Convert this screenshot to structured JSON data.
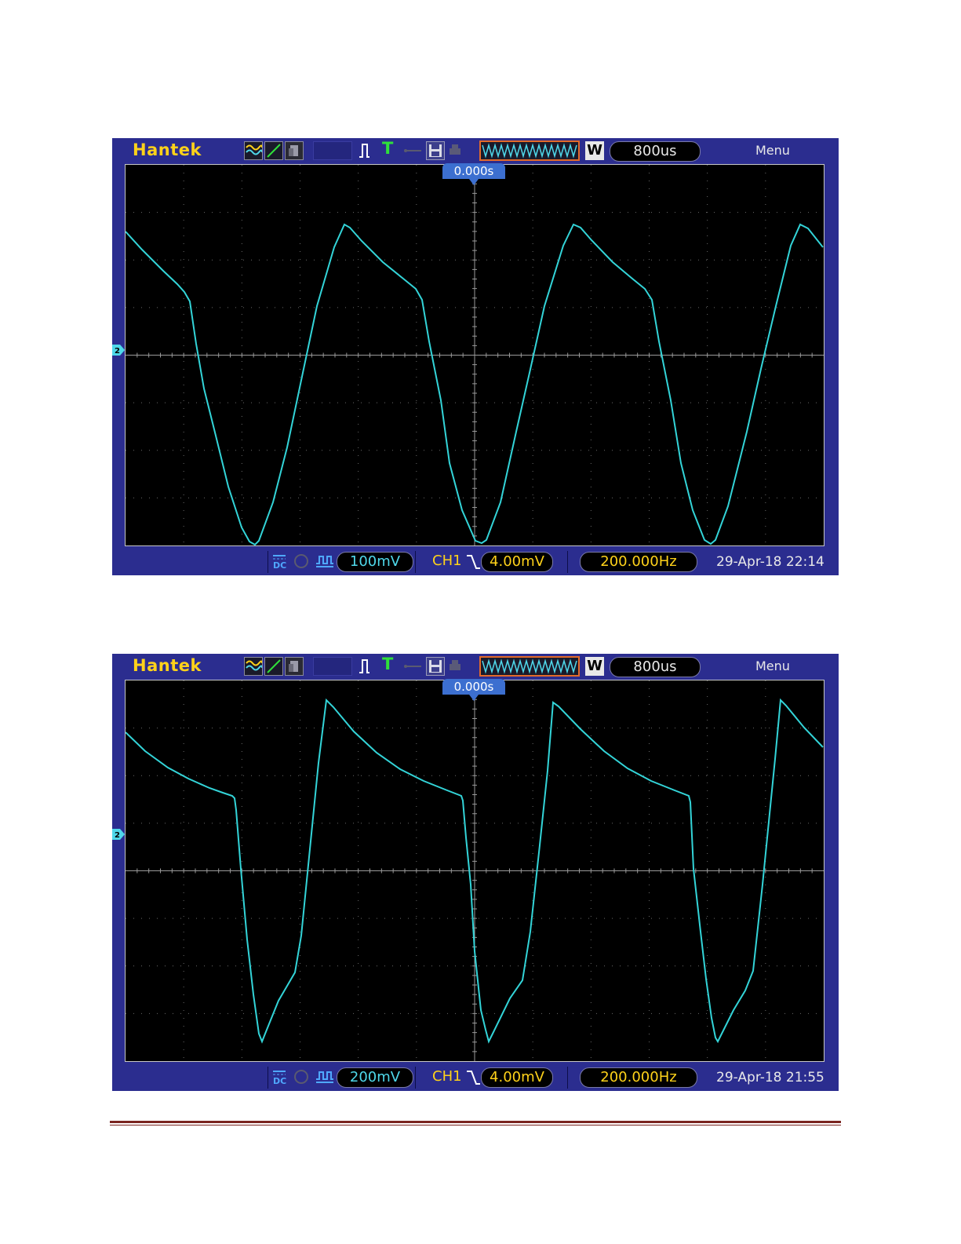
{
  "scopes": [
    {
      "brand": "Hantek",
      "timebase": "800us",
      "menu_label": "Menu",
      "trigger_position": "0.000s",
      "channel_marker": "2",
      "coupling": "DC",
      "volts_per_div": "100mV",
      "trigger_source": "CH1",
      "trigger_level": "4.00mV",
      "frequency": "200.000Hz",
      "datetime": "29-Apr-18 22:14",
      "trace_color": "#33d4d8"
    },
    {
      "brand": "Hantek",
      "timebase": "800us",
      "menu_label": "Menu",
      "trigger_position": "0.000s",
      "channel_marker": "2",
      "coupling": "DC",
      "volts_per_div": "200mV",
      "trigger_source": "CH1",
      "trigger_level": "4.00mV",
      "frequency": "200.000Hz",
      "datetime": "29-Apr-18 21:55",
      "trace_color": "#33d4d8"
    }
  ],
  "icons": {
    "math": "math-wave-icon",
    "cursor": "cursor-icon",
    "ref": "reference-icon",
    "pulse": "pulse-icon",
    "trigger": "trigger-t-icon",
    "usb": "usb-icon",
    "save": "save-disk-icon",
    "print": "printer-icon",
    "waveform": "waveform-memory-icon",
    "window": "window-w-icon"
  },
  "colors": {
    "panel": "#2b2d8f",
    "brand": "#ffd21a",
    "trace": "#33d4d8",
    "channel": "#4fd8ea",
    "trigger": "#ffd21a",
    "footer_rule": "#7a2420"
  }
}
